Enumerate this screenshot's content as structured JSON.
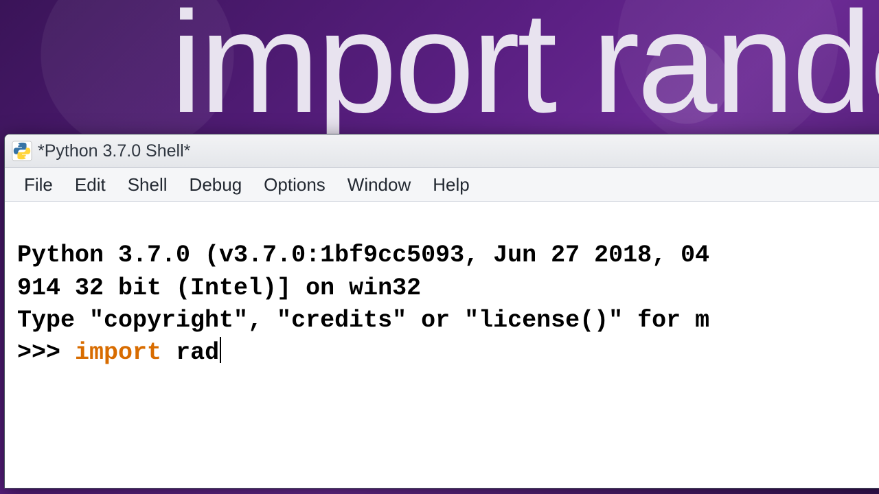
{
  "background": {
    "text": "import random"
  },
  "window": {
    "title": "*Python 3.7.0 Shell*"
  },
  "menu": {
    "items": [
      {
        "label": "File"
      },
      {
        "label": "Edit"
      },
      {
        "label": "Shell"
      },
      {
        "label": "Debug"
      },
      {
        "label": "Options"
      },
      {
        "label": "Window"
      },
      {
        "label": "Help"
      }
    ]
  },
  "console": {
    "line1": "Python 3.7.0 (v3.7.0:1bf9cc5093, Jun 27 2018, 04",
    "line2": "914 32 bit (Intel)] on win32",
    "line3": "Type \"copyright\", \"credits\" or \"license()\" for m",
    "prompt": ">>> ",
    "keyword": "import",
    "typed_space": " ",
    "typed_rest": "rad"
  },
  "colors": {
    "keyword": "#d86c00",
    "bg_primary": "#5a1f82"
  }
}
